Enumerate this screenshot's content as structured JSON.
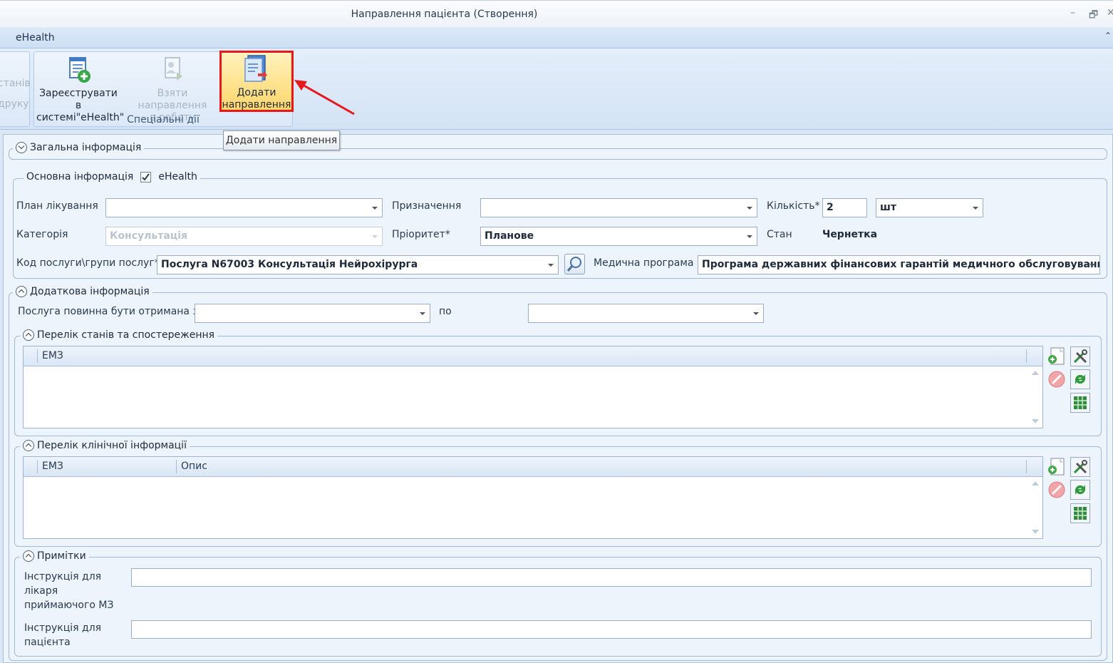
{
  "window": {
    "title": "Направлення пацієнта (Створення)",
    "controls": {
      "minimize": "–",
      "restore": "🗗",
      "close": "✕"
    }
  },
  "ribbon_tab": "eHealth",
  "ribbon": {
    "left_partial": {
      "line1": "станів",
      "line2": "друку"
    },
    "group": {
      "label": "Спеціальні дії",
      "register": {
        "line1": "Зареєструвати в",
        "line2": "системі\"eHealth\""
      },
      "take": {
        "line1": "Взяти направлення",
        "line2": "в роботу"
      },
      "add": {
        "line1": "Додати",
        "line2": "направлення"
      }
    },
    "tooltip": "Додати направлення"
  },
  "general": {
    "legend": "Загальна інформація",
    "main_info": {
      "legend": "Основна інформація",
      "ehealth_label": "eHealth",
      "ehealth_checked": true,
      "plan_label": "План лікування",
      "plan_value": "",
      "purpose_label": "Призначення",
      "purpose_value": "",
      "qty_label": "Кількість*",
      "qty_value": "2",
      "unit_value": "шт",
      "category_label": "Категорія",
      "category_value": "Консультація",
      "priority_label": "Пріоритет*",
      "priority_value": "Планове",
      "state_label": "Стан",
      "state_value": "Чернетка",
      "service_label": "Код послуги\\групи послуг*",
      "service_value": "Послуга N67003 Консультація Нейрохірурга",
      "program_label": "Медична програма",
      "program_value": "Програма державних фінансових гарантій медичного обслуговування н"
    }
  },
  "additional": {
    "legend": "Додаткова інформація",
    "from_label": "Послуга повинна бути отримана з",
    "from_value": "",
    "to_label": "по",
    "to_value": ""
  },
  "conditions": {
    "legend": "Перелік станів та спостереження",
    "columns": [
      "ЕМЗ"
    ]
  },
  "clinical": {
    "legend": "Перелік клінічної інформації",
    "columns": [
      "ЕМЗ",
      "Опис"
    ]
  },
  "notes": {
    "legend": "Примітки",
    "doctor_label": [
      "Інструкція для",
      "лікаря",
      "приймаючого МЗ"
    ],
    "doctor_value": "",
    "patient_label": [
      "Інструкція для",
      "пацієнта"
    ],
    "patient_value": ""
  },
  "toolbar_icons": [
    "add-document-icon",
    "tools-icon",
    "delete-icon",
    "refresh-icon",
    "spreadsheet-icon"
  ]
}
